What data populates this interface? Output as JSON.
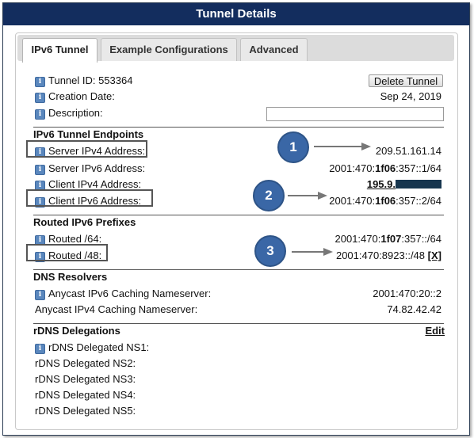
{
  "title": "Tunnel Details",
  "tabs": [
    {
      "label": "IPv6 Tunnel"
    },
    {
      "label": "Example Configurations"
    },
    {
      "label": "Advanced"
    }
  ],
  "tunnel_id_label": "Tunnel ID: 553364",
  "delete_button": "Delete Tunnel",
  "creation_date_label": "Creation Date:",
  "creation_date_value": "Sep 24, 2019",
  "description_label": "Description:",
  "description_value": "",
  "endpoints": {
    "heading": "IPv6 Tunnel Endpoints",
    "server_ipv4_label": "Server IPv4 Address:",
    "server_ipv4_value": "209.51.161.14",
    "server_ipv6_label": "Server IPv6 Address:",
    "server_ipv6_pre": "2001:470:",
    "server_ipv6_bold": "1f06",
    "server_ipv6_post": ":357::1/64",
    "client_ipv4_label": "Client IPv4 Address:",
    "client_ipv4_value": "195.9.",
    "client_ipv6_label": "Client IPv6 Address:",
    "client_ipv6_pre": "2001:470:",
    "client_ipv6_bold": "1f06",
    "client_ipv6_post": ":357::2/64"
  },
  "routed": {
    "heading": "Routed IPv6 Prefixes",
    "r64_label": "Routed /64:",
    "r64_pre": "2001:470:",
    "r64_bold": "1f07",
    "r64_post": ":357::/64",
    "r48_label": "Routed /48:",
    "r48_value": "2001:470:8923::/48",
    "r48_remove": "[X]"
  },
  "dns": {
    "heading": "DNS Resolvers",
    "ipv6_label": "Anycast IPv6 Caching Nameserver:",
    "ipv6_value": "2001:470:20::2",
    "ipv4_label": "Anycast IPv4 Caching Nameserver:",
    "ipv4_value": "74.82.42.42"
  },
  "rdns": {
    "heading": "rDNS Delegations",
    "edit": "Edit",
    "ns1": "rDNS Delegated NS1:",
    "ns2": "rDNS Delegated NS2:",
    "ns3": "rDNS Delegated NS3:",
    "ns4": "rDNS Delegated NS4:",
    "ns5": "rDNS Delegated NS5:"
  },
  "callouts": [
    "1",
    "2",
    "3"
  ],
  "icons": {
    "info": "info-icon",
    "arrow": "arrow-right-icon"
  },
  "colors": {
    "titlebar": "#132d5e",
    "callout": "#3a67a6",
    "info_icon": "#5a87bd"
  }
}
